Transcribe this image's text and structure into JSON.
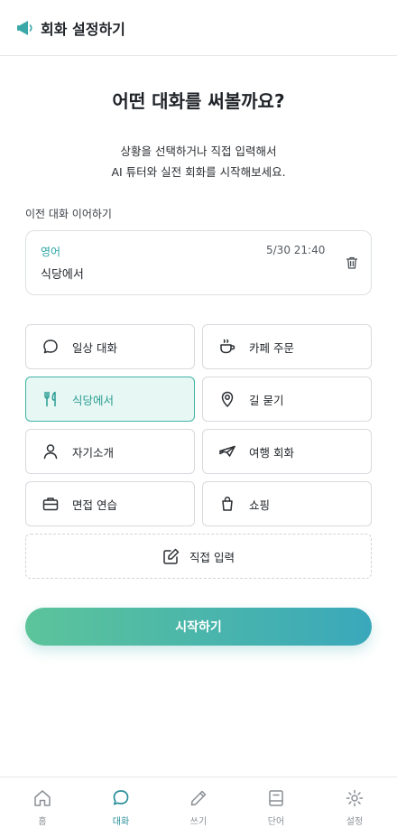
{
  "header": {
    "title": "회화 설정하기",
    "icon": "megaphone-icon"
  },
  "intro": {
    "title": "어떤 대화를 써볼까요?",
    "line1": "상황을 선택하거나 직접 입력해서",
    "line2": "AI 튜터와 실전 회화를 시작해보세요."
  },
  "recent": {
    "section_label": "이전 대화 이어하기",
    "language": "영어",
    "datetime": "5/30 21:40",
    "topic": "식당에서"
  },
  "options": [
    {
      "label": "일상 대화",
      "icon": "chat-bubble-icon"
    },
    {
      "label": "카페 주문",
      "icon": "coffee-cup-icon"
    },
    {
      "label": "식당에서",
      "icon": "fork-knife-icon",
      "selected": true
    },
    {
      "label": "길 묻기",
      "icon": "map-pin-icon"
    },
    {
      "label": "자기소개",
      "icon": "user-icon"
    },
    {
      "label": "여행 회화",
      "icon": "airplane-icon"
    },
    {
      "label": "면접 연습",
      "icon": "briefcase-icon"
    },
    {
      "label": "쇼핑",
      "icon": "shopping-bag-icon"
    }
  ],
  "direct_input": {
    "label": "직접 입력",
    "icon": "edit-icon"
  },
  "start_button": {
    "label": "시작하기"
  },
  "tabs": [
    {
      "label": "홈",
      "icon": "home-icon"
    },
    {
      "label": "대화",
      "icon": "chat-bubble-icon",
      "active": true
    },
    {
      "label": "쓰기",
      "icon": "pencil-icon"
    },
    {
      "label": "단어",
      "icon": "book-icon"
    },
    {
      "label": "설정",
      "icon": "gear-icon"
    }
  ],
  "colors": {
    "accent": "#2aa3a3",
    "selected_bg": "#e7f7f3",
    "gradient_start": "#5cc49a",
    "gradient_end": "#3aa8bb"
  }
}
